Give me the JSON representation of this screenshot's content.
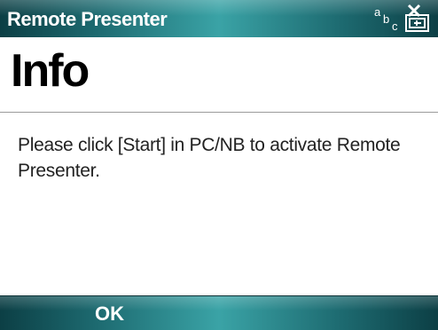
{
  "titlebar": {
    "app_title": "Remote Presenter",
    "input_mode_glyphs": [
      "a",
      "b",
      "c"
    ]
  },
  "header": {
    "title": "Info"
  },
  "content": {
    "message": "Please click [Start] in PC/NB to activate Remote Presenter."
  },
  "softkeys": {
    "left_label": "OK",
    "right_label": ""
  },
  "icons": {
    "close": "close-icon",
    "input_mode": "input-mode-indicator"
  },
  "colors": {
    "bar_dark": "#0c3f45",
    "bar_light": "#3aa3a6",
    "text": "#222222"
  }
}
